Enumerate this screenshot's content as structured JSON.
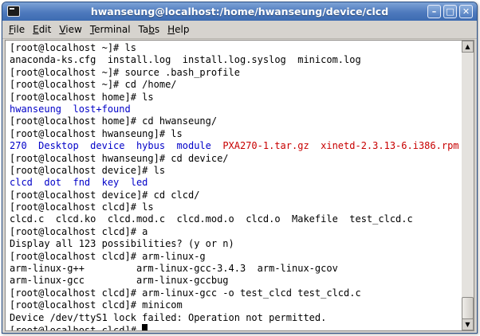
{
  "window": {
    "title": "hwanseung@localhost:/home/hwanseung/device/clcd",
    "minimize_glyph": "–",
    "maximize_glyph": "□",
    "close_glyph": "✕"
  },
  "menu": [
    {
      "underline": "F",
      "rest": "ile"
    },
    {
      "underline": "E",
      "rest": "dit"
    },
    {
      "underline": "V",
      "rest": "iew"
    },
    {
      "underline": "T",
      "rest": "erminal"
    },
    {
      "pre": "Ta",
      "underline": "b",
      "rest": "s"
    },
    {
      "underline": "H",
      "rest": "elp"
    }
  ],
  "terminal": {
    "lines": [
      [
        {
          "t": "[root@localhost ~]# ls"
        }
      ],
      [
        {
          "t": "anaconda-ks.cfg  install.log  install.log.syslog  minicom.log"
        }
      ],
      [
        {
          "t": "[root@localhost ~]# source .bash_profile"
        }
      ],
      [
        {
          "t": "[root@localhost ~]# cd /home/"
        }
      ],
      [
        {
          "t": "[root@localhost home]# ls"
        }
      ],
      [
        {
          "t": "hwanseung  lost+found",
          "c": "blue"
        }
      ],
      [
        {
          "t": "[root@localhost home]# cd hwanseung/"
        }
      ],
      [
        {
          "t": "[root@localhost hwanseung]# ls"
        }
      ],
      [
        {
          "t": "270  Desktop  device  hybus  module  ",
          "c": "blue"
        },
        {
          "t": "PXA270-1.tar.gz  xinetd-2.3.13-6.i386.rpm",
          "c": "red"
        }
      ],
      [
        {
          "t": "[root@localhost hwanseung]# cd device/"
        }
      ],
      [
        {
          "t": "[root@localhost device]# ls"
        }
      ],
      [
        {
          "t": "clcd  dot  fnd  key  led",
          "c": "blue"
        }
      ],
      [
        {
          "t": "[root@localhost device]# cd clcd/"
        }
      ],
      [
        {
          "t": "[root@localhost clcd]# ls"
        }
      ],
      [
        {
          "t": "clcd.c  clcd.ko  clcd.mod.c  clcd.mod.o  clcd.o  Makefile  test_clcd.c"
        }
      ],
      [
        {
          "t": "[root@localhost clcd]# a"
        }
      ],
      [
        {
          "t": "Display all 123 possibilities? (y or n)"
        }
      ],
      [
        {
          "t": "[root@localhost clcd]# arm-linux-g"
        }
      ],
      [
        {
          "t": "arm-linux-g++         arm-linux-gcc-3.4.3  arm-linux-gcov"
        }
      ],
      [
        {
          "t": "arm-linux-gcc         arm-linux-gccbug"
        }
      ],
      [
        {
          "t": "[root@localhost clcd]# arm-linux-gcc -o test_clcd test_clcd.c"
        }
      ],
      [
        {
          "t": "[root@localhost clcd]# minicom"
        }
      ],
      [
        {
          "t": "Device /dev/ttyS1 lock failed: Operation not permitted."
        }
      ],
      [
        {
          "t": "[root@localhost clcd]# "
        },
        {
          "cursor": true
        }
      ]
    ]
  },
  "scrollbar": {
    "up_glyph": "▲",
    "down_glyph": "▼",
    "position_fraction": 1.0
  },
  "colors": {
    "directory": "#0000c8",
    "archive": "#c80000",
    "titlebar": "#4d79bd"
  }
}
